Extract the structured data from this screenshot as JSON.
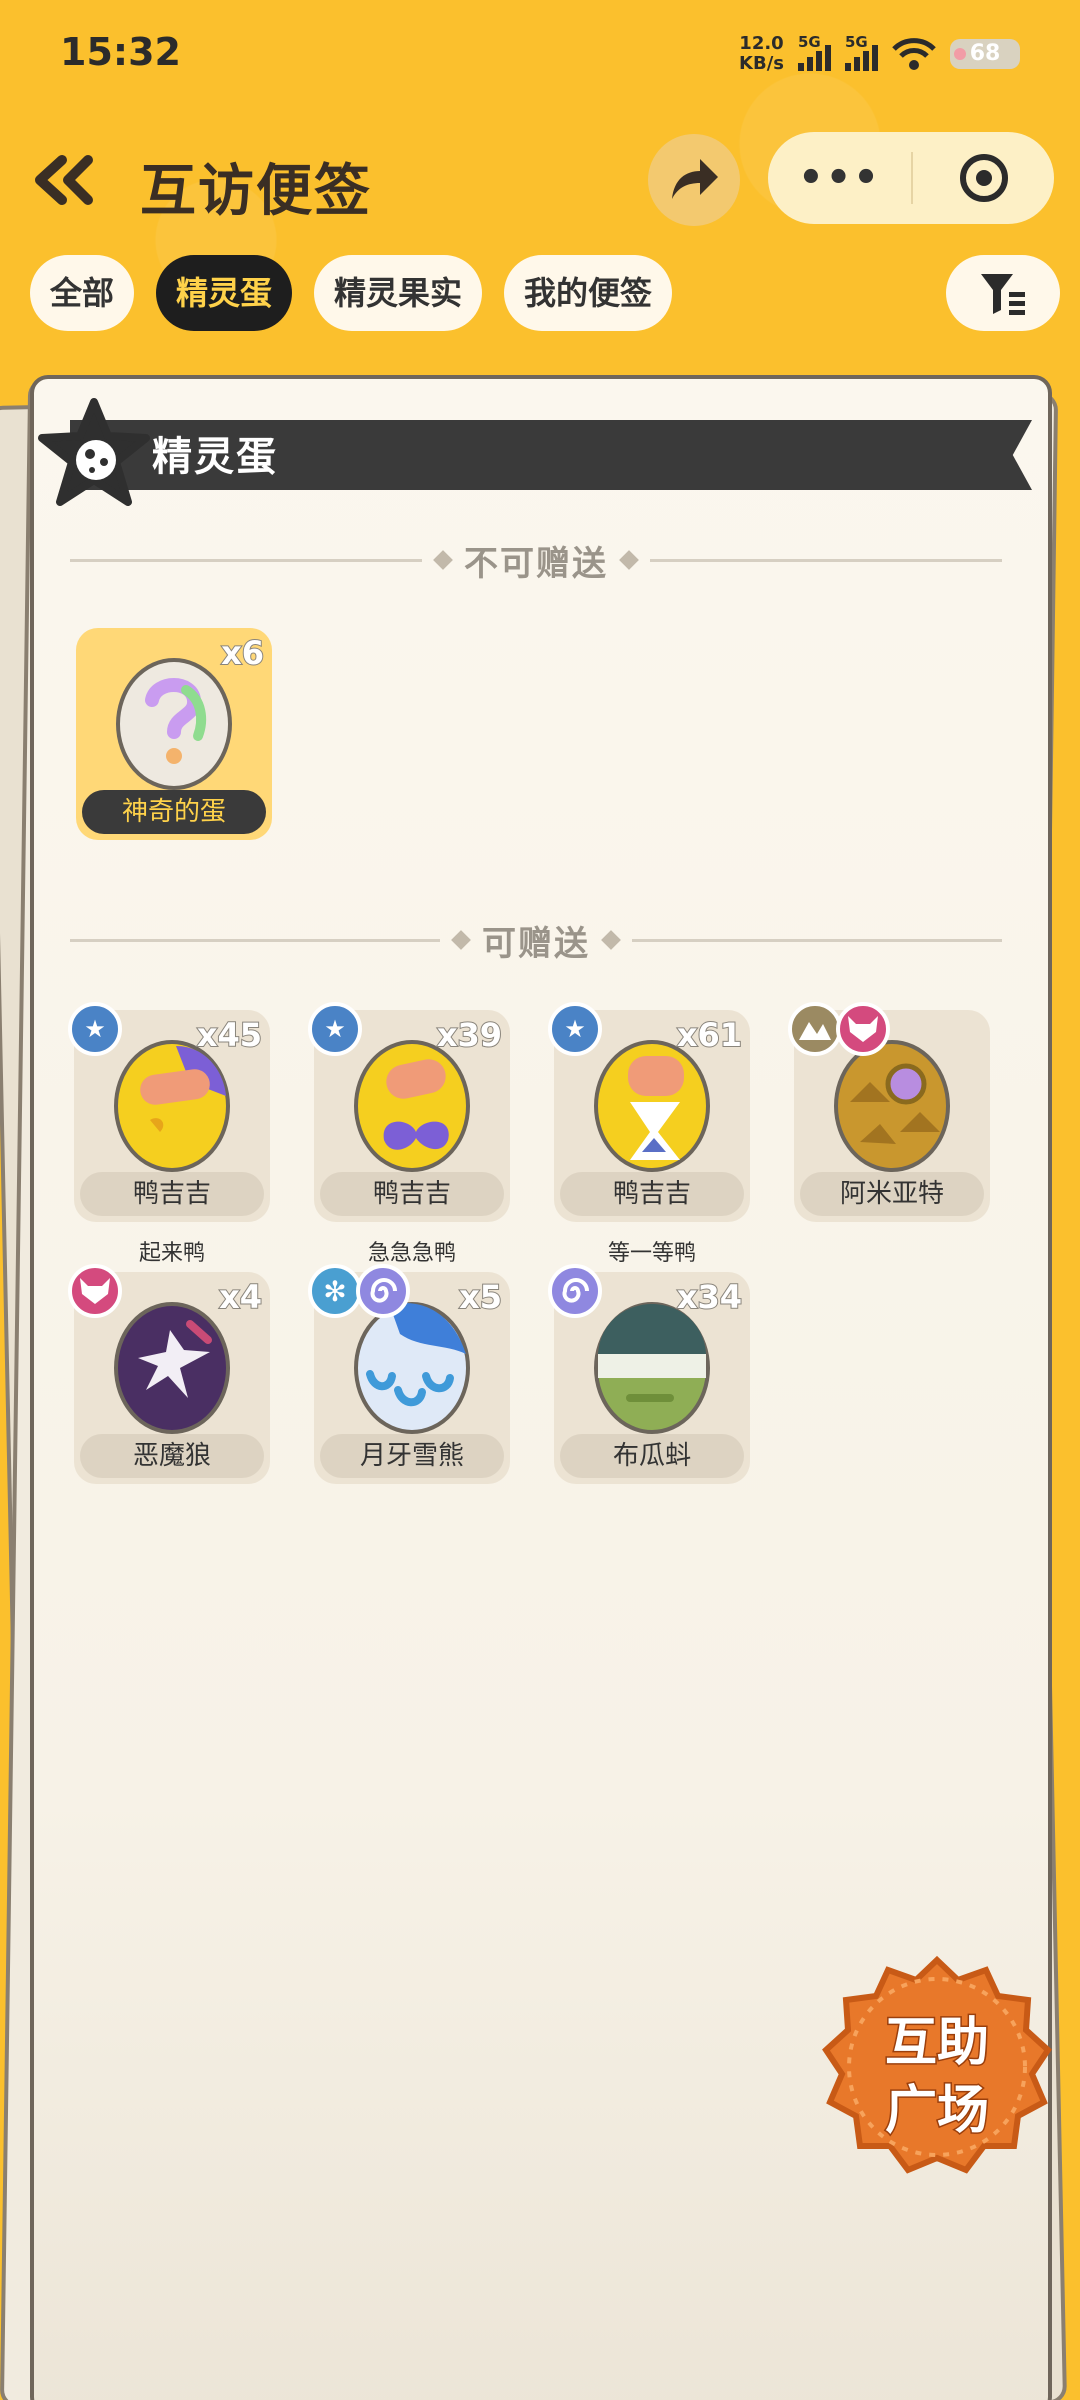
{
  "status": {
    "time": "15:32",
    "net_speed_value": "12.0",
    "net_speed_unit": "KB/s",
    "sim1": "5G",
    "sim2": "5G",
    "battery": "68"
  },
  "header": {
    "title": "互访便签"
  },
  "tabs": [
    {
      "label": "全部",
      "active": false
    },
    {
      "label": "精灵蛋",
      "active": true
    },
    {
      "label": "精灵果实",
      "active": false
    },
    {
      "label": "我的便签",
      "active": false
    }
  ],
  "section": {
    "title": "精灵蛋",
    "not_giftable": {
      "label": "不可赠送",
      "items": [
        {
          "name": "神奇的蛋",
          "count": "x6"
        }
      ]
    },
    "giftable": {
      "label": "可赠送",
      "items": [
        {
          "name": "鸭吉吉",
          "count": "x45",
          "subtitle": "起来鸭"
        },
        {
          "name": "鸭吉吉",
          "count": "x39",
          "subtitle": "急急急鸭"
        },
        {
          "name": "鸭吉吉",
          "count": "x61",
          "subtitle": "等一等鸭"
        },
        {
          "name": "阿米亚特",
          "count": "",
          "subtitle": ""
        },
        {
          "name": "恶魔狼",
          "count": "x4",
          "subtitle": ""
        },
        {
          "name": "月牙雪熊",
          "count": "x5",
          "subtitle": ""
        },
        {
          "name": "布瓜蚪",
          "count": "x34",
          "subtitle": ""
        }
      ]
    }
  },
  "plaza": {
    "line1": "互助",
    "line2": "广场"
  },
  "colors": {
    "background": "#FBC02D",
    "active_tab": "#1E1E1E",
    "active_tab_text": "#FFD24A",
    "plaza": "#E8782A"
  },
  "icons": [
    "back-icon",
    "share-icon",
    "more-icon",
    "target-icon",
    "filter-icon",
    "star-icon",
    "egg-icon"
  ]
}
